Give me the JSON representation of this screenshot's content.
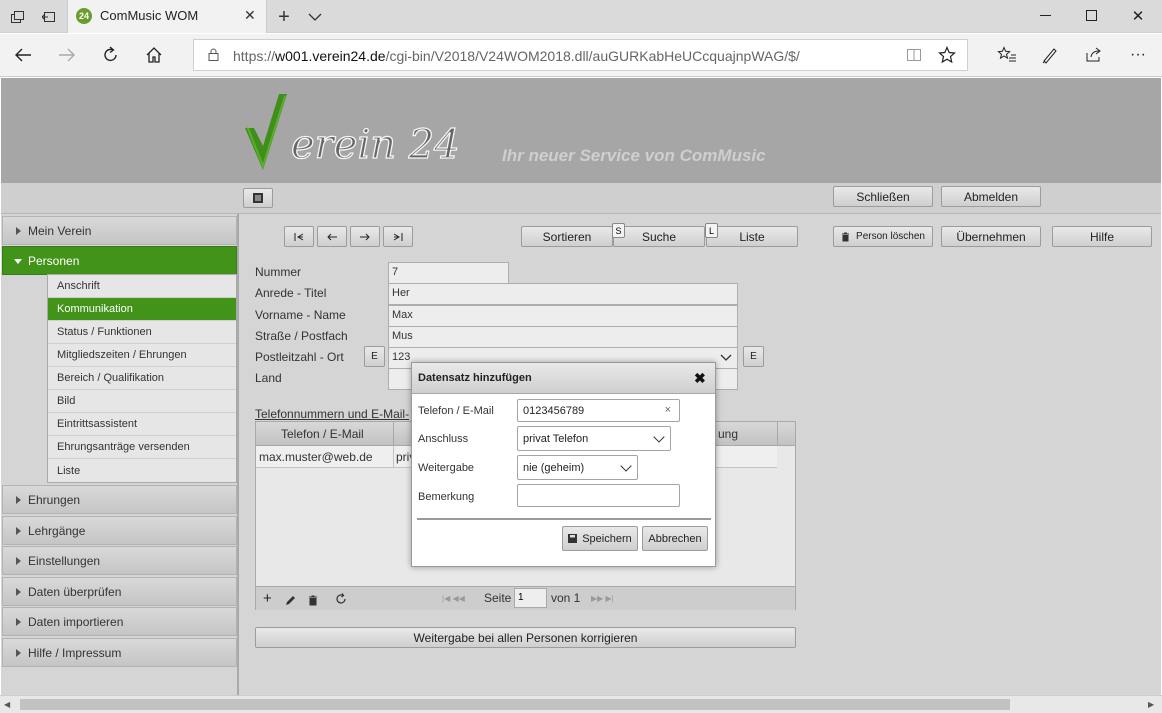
{
  "browser": {
    "tab_title": "ComMusic WOM",
    "favicon_text": "24",
    "url_host": "w001.verein24.de",
    "url_prefix": "https://",
    "url_path": "/cgi-bin/V2018/V24WOM2018.dll/auGURKabHeUCcquajnpWAG/$/"
  },
  "header": {
    "logo_text": "Verein 24",
    "slogan": "Ihr neuer Service von ComMusic",
    "close_label": "Schließen",
    "logout_label": "Abmelden"
  },
  "sidebar": {
    "sections_top": [
      {
        "label": "Mein Verein"
      },
      {
        "label": "Personen"
      }
    ],
    "subitems": [
      {
        "label": "Anschrift"
      },
      {
        "label": "Kommunikation"
      },
      {
        "label": "Status / Funktionen"
      },
      {
        "label": "Mitgliedszeiten / Ehrungen"
      },
      {
        "label": "Bereich / Qualifikation"
      },
      {
        "label": "Bild"
      },
      {
        "label": "Eintrittsassistent"
      },
      {
        "label": "Ehrungsanträge versenden"
      },
      {
        "label": "Liste"
      }
    ],
    "sections_bottom": [
      {
        "label": "Ehrungen"
      },
      {
        "label": "Lehrgänge"
      },
      {
        "label": "Einstellungen"
      },
      {
        "label": "Daten überprüfen"
      },
      {
        "label": "Daten importieren"
      },
      {
        "label": "Hilfe / Impressum"
      }
    ]
  },
  "toolbar": {
    "sort_label": "Sortieren",
    "search_label": "Suche",
    "search_key": "S",
    "list_label": "Liste",
    "list_key": "L",
    "delete_label": "Person löschen",
    "accept_label": "Übernehmen",
    "help_label": "Hilfe"
  },
  "form": {
    "nummer_label": "Nummer",
    "nummer_value": "7",
    "anrede_label": "Anrede - Titel",
    "anrede_value": "Her",
    "vorname_label": "Vorname - Name",
    "vorname_value": "Max",
    "strasse_label": "Straße / Postfach",
    "strasse_value": "Mus",
    "plz_label": "Postleitzahl - Ort",
    "plz_value": "123",
    "e_label": "E",
    "land_label": "Land",
    "section_label": "Telefonnummern und E-Mail-"
  },
  "grid": {
    "col1": "Telefon / E-Mail",
    "col_last": "ung",
    "row_email": "max.muster@web.de",
    "row_partial": "priv",
    "page_label": "Seite",
    "page_value": "1",
    "page_of": "von 1"
  },
  "bottom_button": "Weitergabe bei allen Personen korrigieren",
  "dialog": {
    "title": "Datensatz hinzufügen",
    "phone_label": "Telefon / E-Mail",
    "phone_value": "0123456789",
    "connection_label": "Anschluss",
    "connection_value": "privat Telefon",
    "share_label": "Weitergabe",
    "share_value": "nie (geheim)",
    "note_label": "Bemerkung",
    "note_value": "",
    "save_label": "Speichern",
    "cancel_label": "Abbrechen"
  },
  "colors": {
    "accent_green": "#42931a",
    "header_gray": "#a6a6a6"
  }
}
